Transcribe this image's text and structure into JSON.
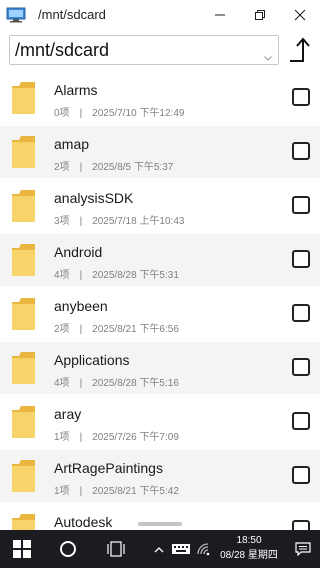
{
  "window": {
    "title": "/mnt/sdcard",
    "icons": [
      "monitor-icon",
      "minimize-icon",
      "maximize-icon",
      "close-icon"
    ]
  },
  "pathbar": {
    "path": "/mnt/sdcard",
    "icons": [
      "chevron-down-icon",
      "parent-folder-icon"
    ]
  },
  "files": [
    {
      "name": "Alarms",
      "count": "0项",
      "separator": "|",
      "modified": "2025/7/10 下午12:49"
    },
    {
      "name": "amap",
      "count": "2项",
      "separator": "|",
      "modified": "2025/8/5 下午5:37"
    },
    {
      "name": "analysisSDK",
      "count": "3项",
      "separator": "|",
      "modified": "2025/7/18 上午10:43"
    },
    {
      "name": "Android",
      "count": "4项",
      "separator": "|",
      "modified": "2025/8/28 下午5:31"
    },
    {
      "name": "anybeen",
      "count": "2项",
      "separator": "|",
      "modified": "2025/8/21 下午6:56"
    },
    {
      "name": "Applications",
      "count": "4项",
      "separator": "|",
      "modified": "2025/8/28 下午5:16"
    },
    {
      "name": "aray",
      "count": "1项",
      "separator": "|",
      "modified": "2025/7/26 下午7:09"
    },
    {
      "name": "ArtRagePaintings",
      "count": "1项",
      "separator": "|",
      "modified": "2025/8/21 下午5:42"
    },
    {
      "name": "Autodesk",
      "count": "",
      "separator": "",
      "modified": ""
    }
  ],
  "taskbar": {
    "time": "18:50",
    "date": "08/28 星期四",
    "icons": [
      "windows-start-icon",
      "search-circle-icon",
      "task-view-icon",
      "tray-chevron-up-icon",
      "keyboard-icon",
      "wifi-icon",
      "notification-icon"
    ]
  },
  "colors": {
    "folder": "#f6cf5a",
    "taskbar": "#1b1c22",
    "alt_row": "#f4f4f4"
  }
}
